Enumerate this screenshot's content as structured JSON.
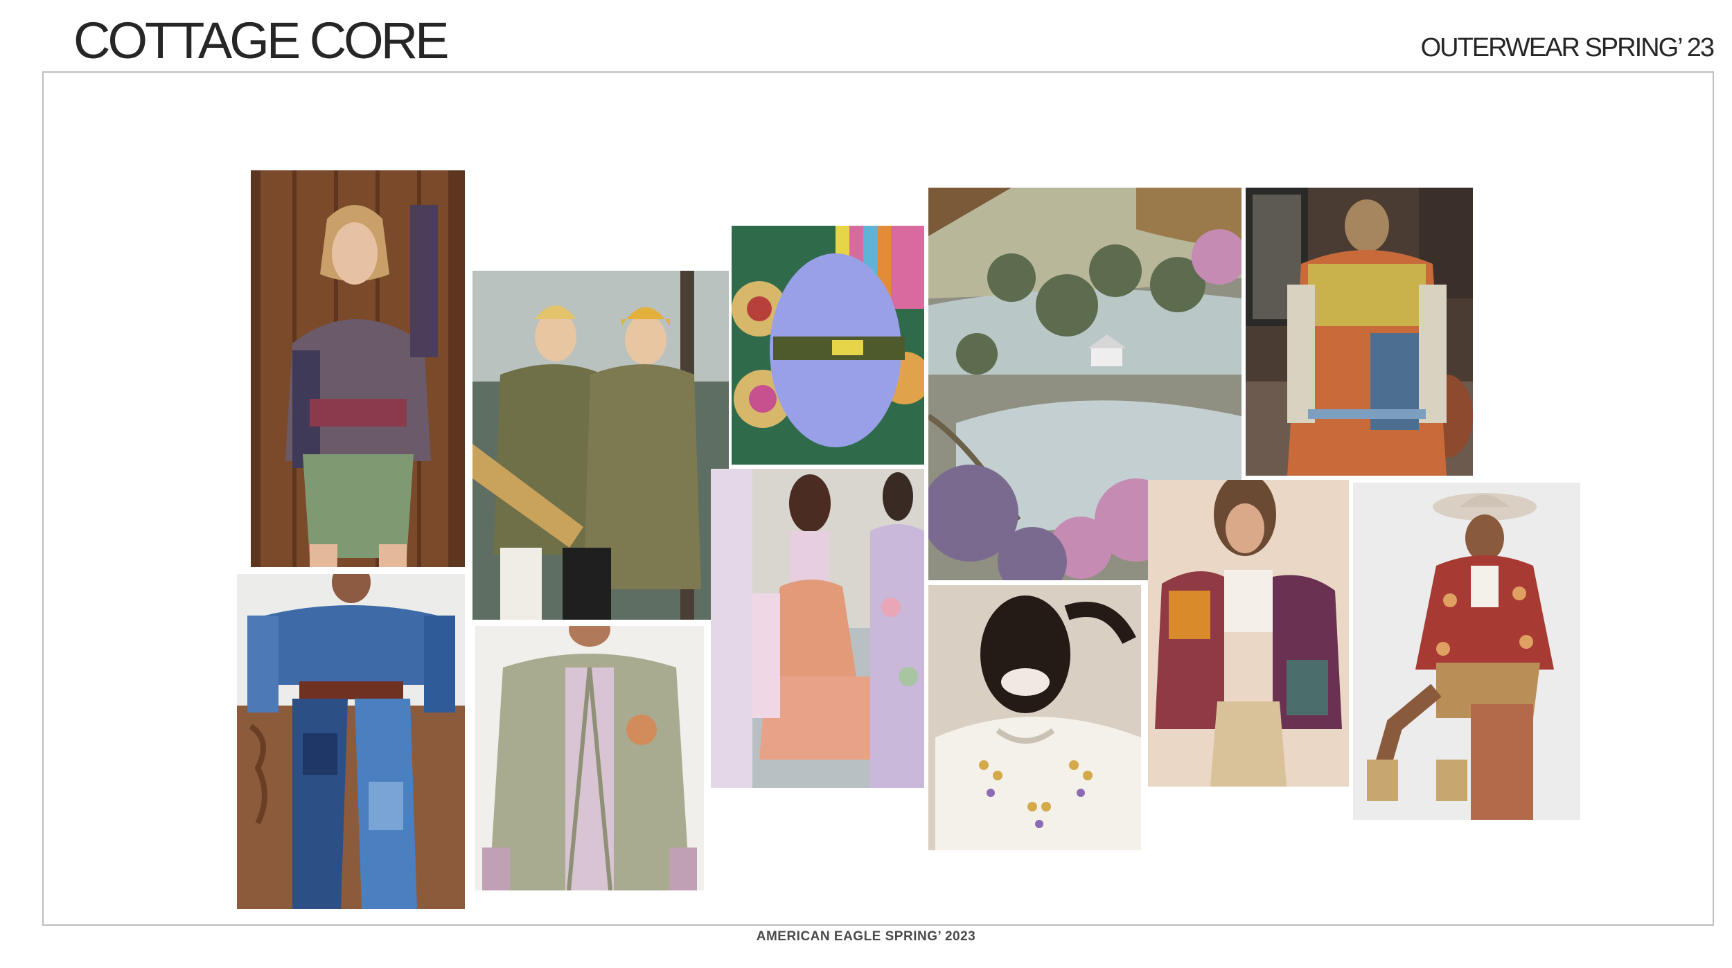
{
  "header": {
    "title": "COTTAGE CORE",
    "subtitle": "OUTERWEAR SPRING’ 23"
  },
  "footer": {
    "text": "AMERICAN EAGLE SPRING’ 2023"
  },
  "moodboard": {
    "photos": [
      {
        "name": "photo-prairie-blouse-wood-wall",
        "subject": "woman in patterned prairie blouse and green shorts against wood wall",
        "colors": {
          "bg": "#7a4a2b",
          "main": "#6b5a6a",
          "accent": "#7f9a72"
        }
      },
      {
        "name": "photo-denim-patchwork-jumpsuit",
        "subject": "model in blue denim patchwork outfit with belt",
        "colors": {
          "bg": "#8c5b3b",
          "main": "#3e6aa8",
          "accent": "#6f3222"
        }
      },
      {
        "name": "photo-quilted-vests-map",
        "subject": "two women in olive quilted vests reading a map",
        "colors": {
          "bg": "#5f6e62",
          "main": "#6f6f48",
          "accent": "#c9a25b"
        }
      },
      {
        "name": "photo-quilted-liner-jacket",
        "subject": "model in sage quilted liner jacket",
        "colors": {
          "bg": "#f1efeb",
          "main": "#a8ab90",
          "accent": "#d8c4d3"
        }
      },
      {
        "name": "photo-crochet-fur-slide",
        "subject": "lavender fur slide on crochet granny squares",
        "colors": {
          "bg": "#2f6b4a",
          "main": "#9aa0e8",
          "accent": "#d86aa0"
        }
      },
      {
        "name": "photo-peach-ruffle-dresses",
        "subject": "models in peach ruffled slip dress and floral prints",
        "colors": {
          "bg": "#d9d6d0",
          "main": "#e29a78",
          "accent": "#c9b8d9"
        }
      },
      {
        "name": "photo-countryside-landscape",
        "subject": "frosted countryside with cottage and blossoming trees",
        "colors": {
          "bg": "#8f8f82",
          "main": "#b9c7c6",
          "accent": "#c58bb3"
        }
      },
      {
        "name": "photo-embroidered-knit-smile",
        "subject": "smiling model in white embroidered knit collar",
        "colors": {
          "bg": "#d9cfc2",
          "main": "#f4f1ea",
          "accent": "#d3a94a"
        }
      },
      {
        "name": "photo-patchwork-coat-back",
        "subject": "back view of patchwork quilt coat on a city street",
        "colors": {
          "bg": "#4a3c33",
          "main": "#c9b24b",
          "accent": "#c96a3a"
        }
      },
      {
        "name": "photo-quilted-bomber",
        "subject": "model in multicolor quilted patchwork bomber jacket",
        "colors": {
          "bg": "#ead7c5",
          "main": "#8f3a45",
          "accent": "#d98a2b"
        }
      },
      {
        "name": "photo-paisley-jacket-hat",
        "subject": "model in red paisley jacket and felt hat sitting on crate",
        "colors": {
          "bg": "#ececec",
          "main": "#a83a34",
          "accent": "#b98e57"
        }
      }
    ]
  }
}
